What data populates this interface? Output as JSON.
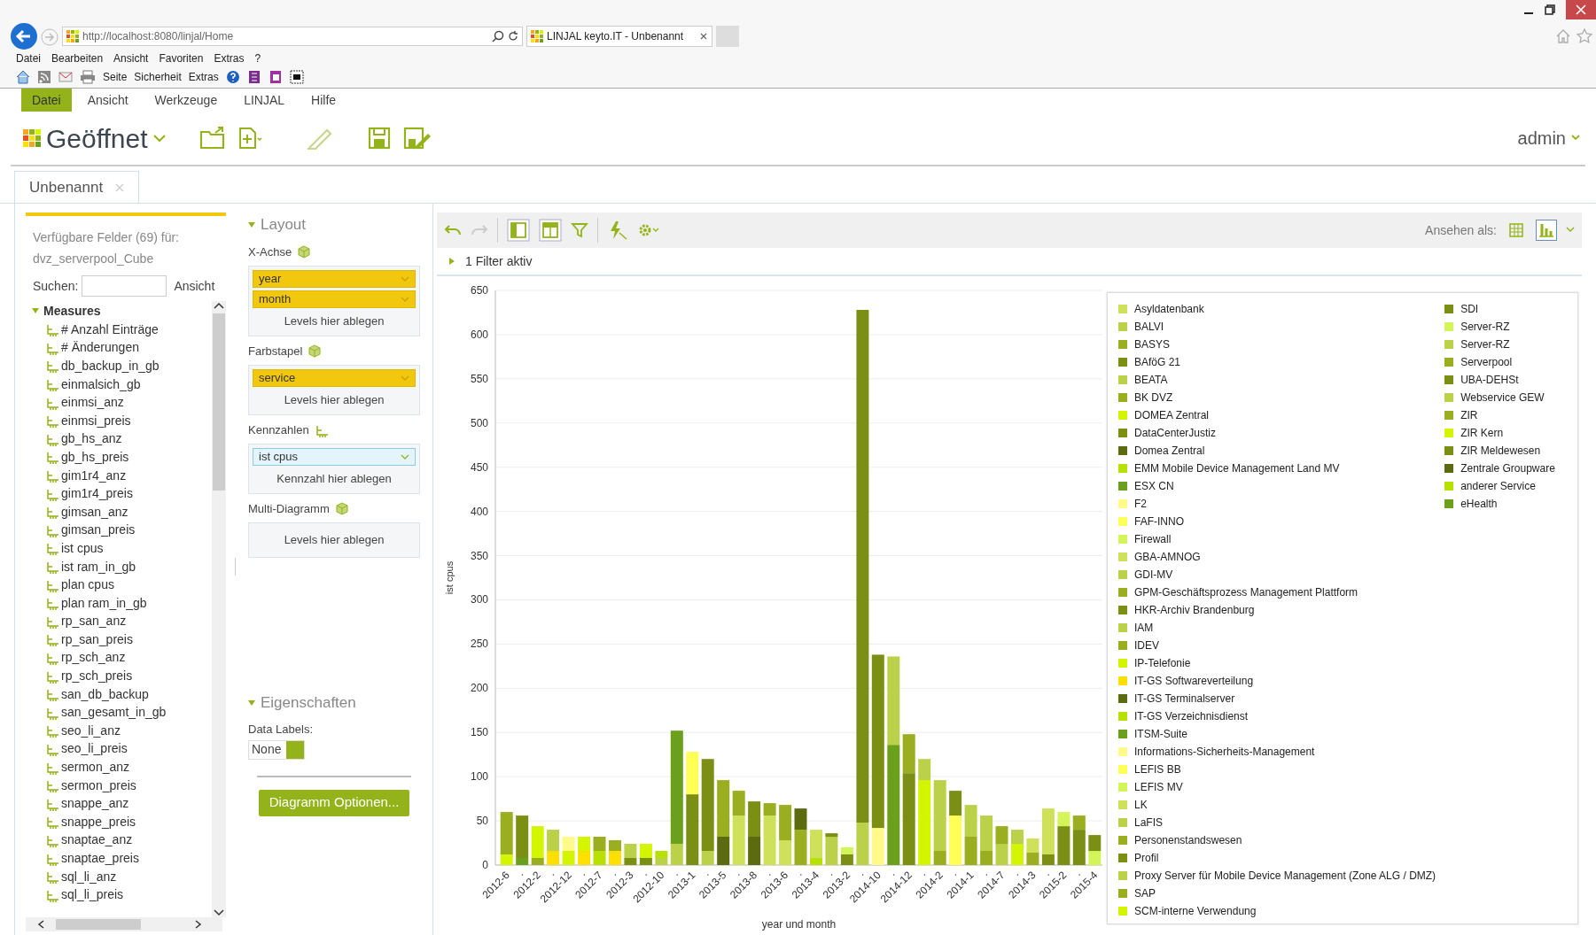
{
  "browser": {
    "url": "http://localhost:8080/linjal/Home",
    "tab_title": "LINJAL keyto.IT - Unbenannt",
    "menu": [
      "Datei",
      "Bearbeiten",
      "Ansicht",
      "Favoriten",
      "Extras",
      "?"
    ],
    "toolbar": [
      "Seite",
      "Sicherheit",
      "Extras"
    ]
  },
  "app": {
    "menu": [
      {
        "label": "Datei",
        "selected": true
      },
      {
        "label": "Ansicht",
        "selected": false
      },
      {
        "label": "Werkzeuge",
        "selected": false
      },
      {
        "label": "LINJAL",
        "selected": false
      },
      {
        "label": "Hilfe",
        "selected": false
      }
    ],
    "title": "Geöffnet",
    "user": "admin"
  },
  "doc_tabs": [
    {
      "label": "Unbenannt",
      "selected": true
    }
  ],
  "fields_panel": {
    "heading": "Verfügbare Felder (69) für:",
    "cube": "dvz_serverpool_Cube",
    "search_label": "Suchen:",
    "view_label": "Ansicht",
    "tree": [
      {
        "label": "Measures",
        "expanded": true,
        "children": [
          {
            "label": "# Anzahl Einträge"
          },
          {
            "label": "# Änderungen"
          },
          {
            "label": "db_backup_in_gb"
          },
          {
            "label": "einmalsich_gb"
          },
          {
            "label": "einmsi_anz"
          },
          {
            "label": "einmsi_preis"
          },
          {
            "label": "gb_hs_anz"
          },
          {
            "label": "gb_hs_preis"
          },
          {
            "label": "gim1r4_anz"
          },
          {
            "label": "gim1r4_preis"
          },
          {
            "label": "gimsan_anz"
          },
          {
            "label": "gimsan_preis"
          },
          {
            "label": "ist cpus"
          },
          {
            "label": "ist ram_in_gb"
          },
          {
            "label": "plan cpus"
          },
          {
            "label": "plan ram_in_gb"
          },
          {
            "label": "rp_san_anz"
          },
          {
            "label": "rp_san_preis"
          },
          {
            "label": "rp_sch_anz"
          },
          {
            "label": "rp_sch_preis"
          },
          {
            "label": "san_db_backup"
          },
          {
            "label": "san_gesamt_in_gb"
          },
          {
            "label": "seo_li_anz"
          },
          {
            "label": "seo_li_preis"
          },
          {
            "label": "sermon_anz"
          },
          {
            "label": "sermon_preis"
          },
          {
            "label": "snappe_anz"
          },
          {
            "label": "snappe_preis"
          },
          {
            "label": "snaptae_anz"
          },
          {
            "label": "snaptae_preis"
          },
          {
            "label": "sql_li_anz"
          },
          {
            "label": "sql_li_preis"
          }
        ]
      }
    ]
  },
  "layout_panel": {
    "title": "Layout",
    "sections": [
      {
        "label": "X-Achse",
        "kind": "levels",
        "chips": [
          {
            "label": "year",
            "kind": "level"
          },
          {
            "label": "month",
            "kind": "level"
          }
        ],
        "drop_hint": "Levels hier ablegen"
      },
      {
        "label": "Farbstapel",
        "kind": "levels",
        "chips": [
          {
            "label": "service",
            "kind": "level"
          }
        ],
        "drop_hint": "Levels hier ablegen"
      },
      {
        "label": "Kennzahlen",
        "kind": "measures",
        "chips": [
          {
            "label": "ist cpus",
            "kind": "measure"
          }
        ],
        "drop_hint": "Kennzahl hier ablegen"
      },
      {
        "label": "Multi-Diagramm",
        "kind": "levels",
        "drop_hint": "Levels hier ablegen"
      }
    ],
    "properties": {
      "title": "Eigenschaften",
      "data_labels_label": "Data Labels:",
      "data_labels_value": "None",
      "button": "Diagramm Optionen..."
    }
  },
  "chart_panel": {
    "view_label": "Ansehen als:",
    "views": [
      {
        "kind": "table",
        "selected": false
      },
      {
        "kind": "chart",
        "selected": true
      }
    ],
    "filter": "1 Filter aktiv",
    "chart_data": {
      "type": "bar",
      "stacked": true,
      "grid": true,
      "xlabel": "year und month",
      "ylabel": "ist cpus",
      "ylim": [
        0,
        650
      ],
      "yticks": [
        0,
        50,
        100,
        150,
        200,
        250,
        300,
        350,
        400,
        450,
        500,
        550,
        600,
        650
      ],
      "categories": [
        "2012-6",
        "·",
        "2012-2",
        "·",
        "2012-12",
        "·",
        "2012-7",
        "·",
        "2012-3",
        "·",
        "2012-10",
        "·",
        "2013-1",
        "·",
        "2013-5",
        "·",
        "2013-8",
        "·",
        "2013-6",
        "·",
        "2013-4",
        "·",
        "2013-2",
        "·",
        "2014-10",
        "·",
        "2014-12",
        "·",
        "2014-2",
        "·",
        "2014-1",
        "·",
        "2014-7",
        "·",
        "2014-3",
        "·",
        "2015-2",
        "·",
        "2015-4"
      ],
      "series": [
        {
          "colors": [
            "#d4f500",
            "#6aa01c",
            "#9aae20",
            "#ffe000",
            "#d4f500",
            "#ffe000",
            "#b8e000",
            "#ffe000",
            "#7a8f14",
            "#7a8f14",
            "#bcd14a",
            "#bcd14a",
            "#7a8f14",
            "#bcd14a",
            "#5c6b10",
            "#cfe05a",
            "#5c6b10",
            "#cfe05a",
            "#cfe05a",
            "#9aae20",
            "#b8e000",
            "#bcd14a",
            "#7a8f14",
            "#bcd14a",
            "#fffa8a",
            "#6aa01c",
            "#7a8f14",
            "#d4f500",
            "#9aae20",
            "#ffff55",
            "#9aae20",
            "#9aae20",
            "#bcd14a",
            "#d4f500",
            "#9aae20",
            "#7a8f14",
            "#7a8f14",
            "#7a8f14",
            "#d4f55a"
          ],
          "values": [
            12,
            8,
            8,
            16,
            16,
            16,
            16,
            16,
            8,
            8,
            8,
            24,
            80,
            16,
            32,
            56,
            32,
            56,
            28,
            40,
            8,
            32,
            12,
            48,
            42,
            136,
            104,
            96,
            16,
            56,
            32,
            16,
            24,
            24,
            14,
            12,
            44,
            40,
            16
          ]
        },
        {
          "colors": [
            "#9aae20",
            "#7a8f14",
            "#d4f500",
            "#bcd14a",
            "#fffa8a",
            "#d4f500",
            "#9aae20",
            "#9aae20",
            "#bcd14a",
            "#d4f500",
            "#b8e000",
            "#6aa01c",
            "#ffff55",
            "#7a8f14",
            "#9aae20",
            "#9aae20",
            "#7a8f14",
            "#9aae20",
            "#9aae20",
            "#5c6b10",
            "#cfe05a",
            "#7a8f14",
            "#d4f55a",
            "#7a8f14",
            "#7a8f14",
            "#bcd14a",
            "#9aae20",
            "#bcd14a",
            "#bcd14a",
            "#7a8f14",
            "#bcd14a",
            "#bcd14a",
            "#9aae20",
            "#bcd14a",
            "#cfe05a",
            "#cfe05a",
            "#d4f55a",
            "#9aae20",
            "#7a8f14"
          ],
          "values": [
            48,
            48,
            36,
            24,
            16,
            16,
            16,
            12,
            16,
            16,
            8,
            128,
            48,
            104,
            64,
            28,
            40,
            14,
            40,
            24,
            32,
            4,
            8,
            580,
            196,
            100,
            44,
            24,
            80,
            28,
            36,
            40,
            20,
            16,
            16,
            52,
            16,
            16,
            18
          ]
        }
      ]
    },
    "legend": [
      {
        "label": "Asyldatenbank",
        "color": "#cfe05a"
      },
      {
        "label": "BALVI",
        "color": "#bcd14a"
      },
      {
        "label": "BASYS",
        "color": "#9aae20"
      },
      {
        "label": "BAföG 21",
        "color": "#7a8f14"
      },
      {
        "label": "BEATA",
        "color": "#bcd14a"
      },
      {
        "label": "BK DVZ",
        "color": "#9aae20"
      },
      {
        "label": "DOMEA Zentral",
        "color": "#d4f500"
      },
      {
        "label": "DataCenterJustiz",
        "color": "#7a8f14"
      },
      {
        "label": "Domea Zentral",
        "color": "#5c6b10"
      },
      {
        "label": "EMM Mobile Device Management Land MV",
        "color": "#b8e000"
      },
      {
        "label": "ESX CN",
        "color": "#6aa01c"
      },
      {
        "label": "F2",
        "color": "#fffa8a"
      },
      {
        "label": "FAF-INNO",
        "color": "#ffff55"
      },
      {
        "label": "Firewall",
        "color": "#d4f55a"
      },
      {
        "label": "GBA-AMNOG",
        "color": "#cfe05a"
      },
      {
        "label": "GDI-MV",
        "color": "#bcd14a"
      },
      {
        "label": "GPM-Geschäftsprozess Management Plattform",
        "color": "#9aae20"
      },
      {
        "label": "HKR-Archiv Brandenburg",
        "color": "#7a8f14"
      },
      {
        "label": "IAM",
        "color": "#bcd14a"
      },
      {
        "label": "IDEV",
        "color": "#9aae20"
      },
      {
        "label": "IP-Telefonie",
        "color": "#d4f500"
      },
      {
        "label": "IT-GS Softwareverteilung",
        "color": "#ffe000"
      },
      {
        "label": "IT-GS Terminalserver",
        "color": "#5c6b10"
      },
      {
        "label": "IT-GS Verzeichnisdienst",
        "color": "#b8e000"
      },
      {
        "label": "ITSM-Suite",
        "color": "#6aa01c"
      },
      {
        "label": "Informations-Sicherheits-Management",
        "color": "#fffa8a"
      },
      {
        "label": "LEFIS BB",
        "color": "#ffff55"
      },
      {
        "label": "LEFIS MV",
        "color": "#d4f55a"
      },
      {
        "label": "LK",
        "color": "#cfe05a"
      },
      {
        "label": "LaFIS",
        "color": "#bcd14a"
      },
      {
        "label": "Personenstandswesen",
        "color": "#9aae20"
      },
      {
        "label": "Profil",
        "color": "#7a8f14"
      },
      {
        "label": "Proxy Server für Mobile Device Management (Zone ALG / DMZ)",
        "color": "#bcd14a"
      },
      {
        "label": "SAP",
        "color": "#9aae20"
      },
      {
        "label": "SCM-interne Verwendung",
        "color": "#d4f500"
      },
      {
        "label": "SDI",
        "color": "#7a8f14"
      },
      {
        "label": "Server-RZ",
        "color": "#d4f55a"
      },
      {
        "label": "Server-RZ",
        "color": "#bcd14a"
      },
      {
        "label": "Serverpool",
        "color": "#9aae20"
      },
      {
        "label": "UBA-DEHSt",
        "color": "#7a8f14"
      },
      {
        "label": "Webservice GEW",
        "color": "#bcd14a"
      },
      {
        "label": "ZIR",
        "color": "#9aae20"
      },
      {
        "label": "ZIR Kern",
        "color": "#d4f500"
      },
      {
        "label": "ZIR Meldewesen",
        "color": "#7a8f14"
      },
      {
        "label": "Zentrale Groupware",
        "color": "#5c6b10"
      },
      {
        "label": "anderer Service",
        "color": "#b8e000"
      },
      {
        "label": "eHealth",
        "color": "#6aa01c"
      }
    ]
  }
}
